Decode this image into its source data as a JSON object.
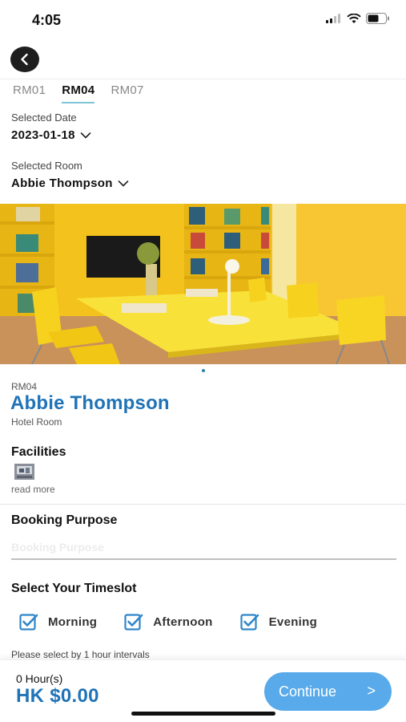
{
  "status_bar": {
    "time": "4:05",
    "icons": [
      "cellular-signal-icon",
      "wifi-icon",
      "battery-icon"
    ]
  },
  "nav": {
    "back_icon": "chevron-left-icon"
  },
  "tabs": [
    {
      "label": "RM01",
      "active": false
    },
    {
      "label": "RM04",
      "active": true
    },
    {
      "label": "RM07",
      "active": false
    }
  ],
  "selected_date": {
    "label": "Selected Date",
    "value": "2023-01-18"
  },
  "selected_room": {
    "label": "Selected Room",
    "value": "Abbie Thompson"
  },
  "room": {
    "code": "RM04",
    "name": "Abbie Thompson",
    "type": "Hotel Room"
  },
  "facilities": {
    "title": "Facilities",
    "read_more": "read more"
  },
  "booking_purpose": {
    "title": "Booking Purpose",
    "placeholder": "Booking Purpose",
    "value": ""
  },
  "timeslot": {
    "title": "Select Your Timeslot",
    "options": [
      {
        "label": "Morning",
        "checked": true
      },
      {
        "label": "Afternoon",
        "checked": true
      },
      {
        "label": "Evening",
        "checked": true
      }
    ],
    "hint": "Please select by 1 hour intervals"
  },
  "footer": {
    "hours": "0 Hour(s)",
    "price": "HK $0.00",
    "continue_label": "Continue",
    "continue_icon": ">"
  },
  "colors": {
    "accent_blue": "#1f73b7",
    "button_blue": "#58aaea",
    "checkbox_blue": "#2f86c9",
    "tab_underline": "#7fc4d6",
    "room_yellow": "#f5c51a"
  }
}
